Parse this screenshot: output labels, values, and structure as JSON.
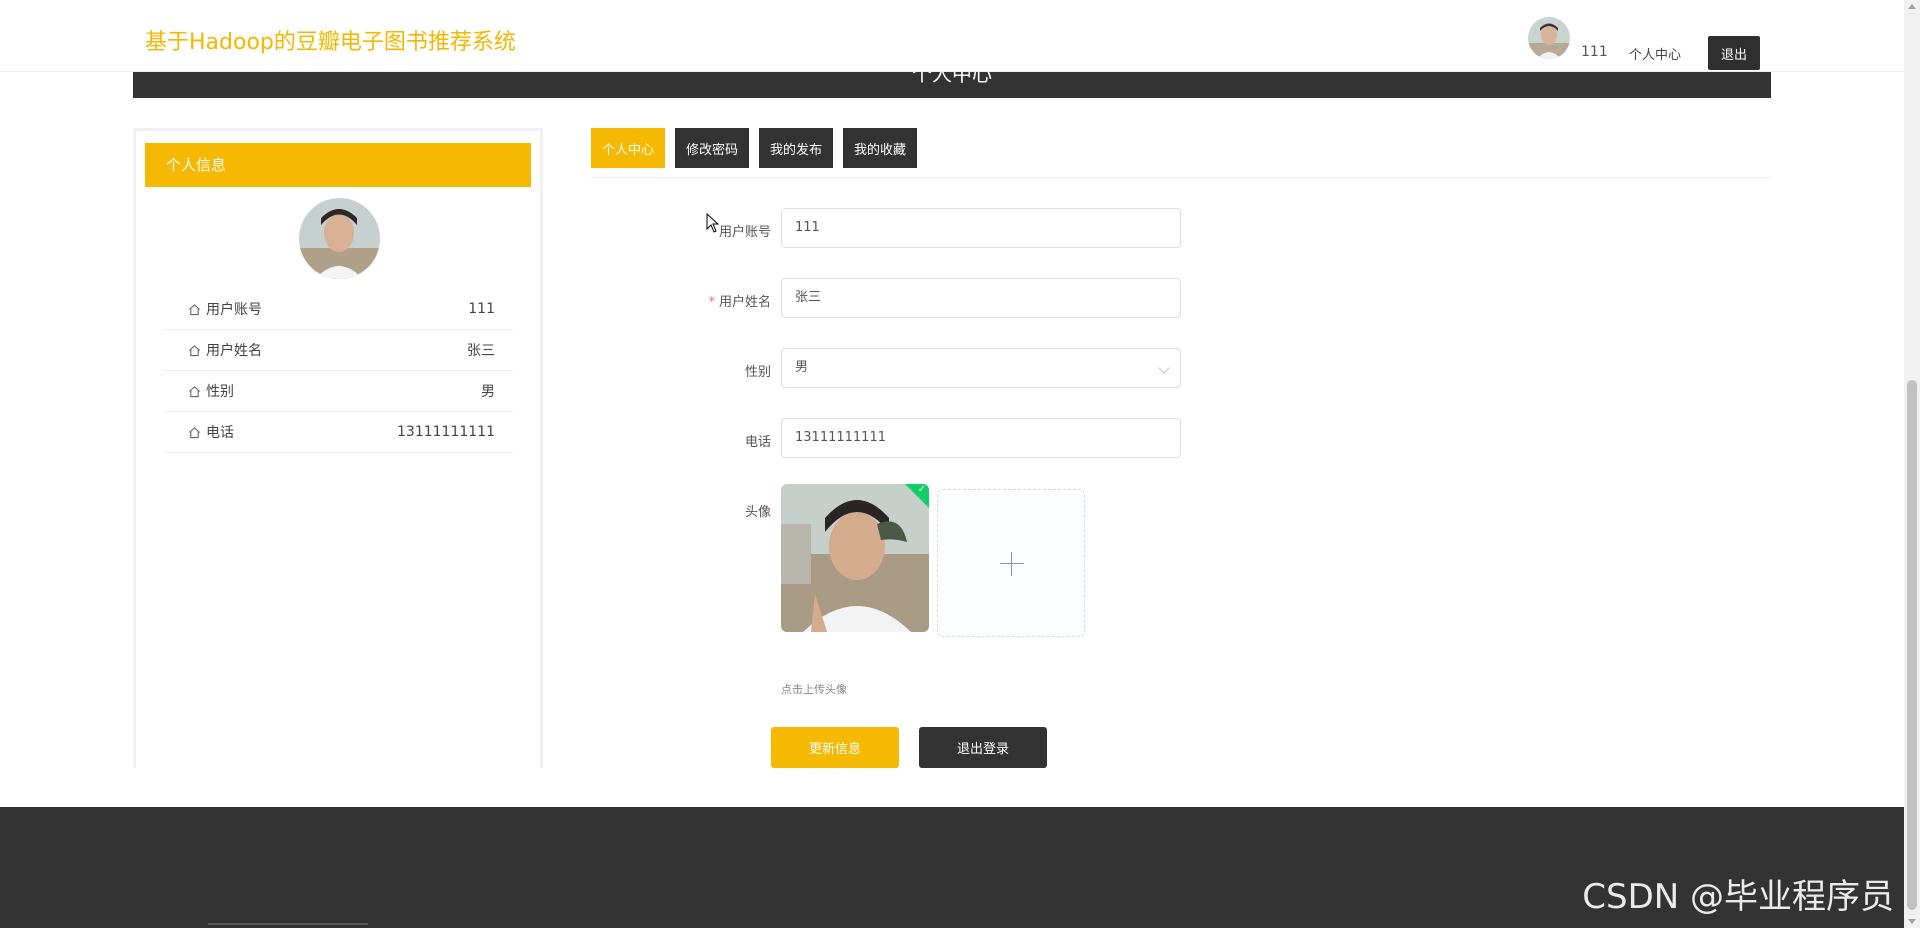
{
  "header": {
    "site_title": "基于Hadoop的豆瓣电子图书推荐系统",
    "user_name": "111",
    "user_center_label": "个人中心",
    "logout_label": "退出"
  },
  "banner": {
    "title": "个人中心"
  },
  "sidebar": {
    "title": "个人信息",
    "items": [
      {
        "label": "用户账号",
        "value": "111",
        "icon": "home-icon"
      },
      {
        "label": "用户姓名",
        "value": "张三",
        "icon": "home-icon"
      },
      {
        "label": "性别",
        "value": "男",
        "icon": "home-icon"
      },
      {
        "label": "电话",
        "value": "13111111111",
        "icon": "home-icon"
      }
    ]
  },
  "tabs": [
    {
      "label": "个人中心",
      "active": true
    },
    {
      "label": "修改密码",
      "active": false
    },
    {
      "label": "我的发布",
      "active": false
    },
    {
      "label": "我的收藏",
      "active": false
    }
  ],
  "form": {
    "account": {
      "label": "用户账号",
      "value": "111"
    },
    "name": {
      "label": "用户姓名",
      "value": "张三",
      "required_mark": "*"
    },
    "gender": {
      "label": "性别",
      "value": "男"
    },
    "phone": {
      "label": "电话",
      "value": "13111111111"
    },
    "avatar": {
      "label": "头像",
      "upload_tip": "点击上传头像",
      "upload_plus": "+"
    },
    "update_button": "更新信息",
    "logout_button": "退出登录"
  },
  "watermark": "CSDN @毕业程序员",
  "colors": {
    "accent": "#f4b900",
    "dark": "#333333",
    "success": "#13ce66"
  }
}
